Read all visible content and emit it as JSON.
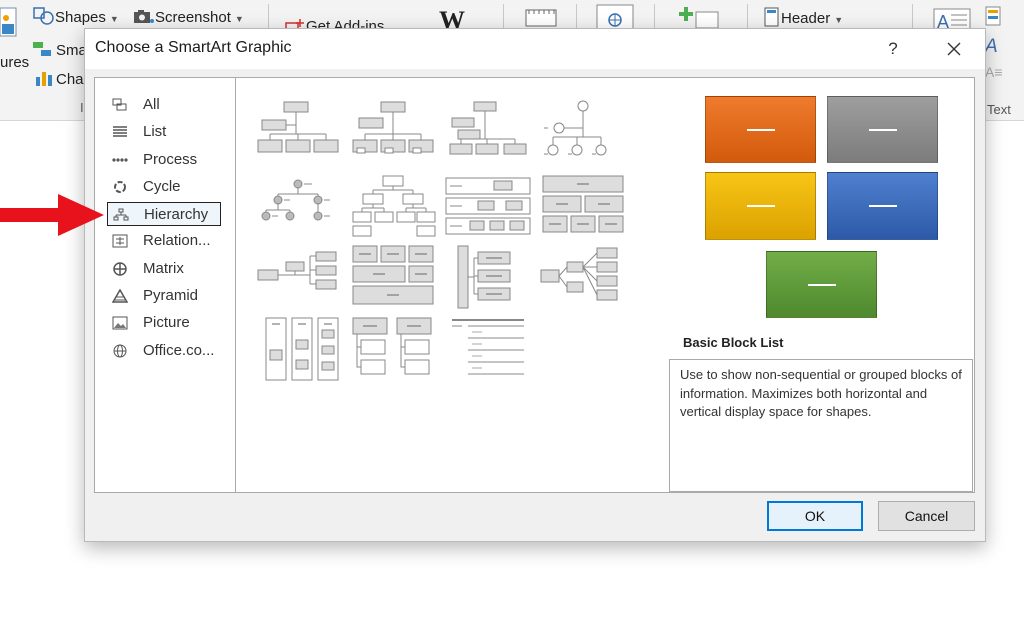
{
  "ribbon": {
    "shapes": "Shapes",
    "screenshot": "Screenshot",
    "smartart_partial": "Sma",
    "chart_partial": "Cha",
    "pictures_partial": "ures",
    "get_addins": "Get Add-ins",
    "wikipedia_glyph": "W",
    "header": "Header",
    "text_group": "Text",
    "illustrations_partial": "Il"
  },
  "dialog": {
    "title": "Choose a SmartArt Graphic",
    "help": "?",
    "categories": [
      {
        "label": "All",
        "icon": "all-icon"
      },
      {
        "label": "List",
        "icon": "list-icon"
      },
      {
        "label": "Process",
        "icon": "process-icon"
      },
      {
        "label": "Cycle",
        "icon": "cycle-icon"
      },
      {
        "label": "Hierarchy",
        "icon": "hierarchy-icon"
      },
      {
        "label": "Relation...",
        "icon": "relationship-icon"
      },
      {
        "label": "Matrix",
        "icon": "matrix-icon"
      },
      {
        "label": "Pyramid",
        "icon": "pyramid-icon"
      },
      {
        "label": "Picture",
        "icon": "picture-icon"
      },
      {
        "label": "Office.co...",
        "icon": "globe-icon"
      }
    ],
    "selected_category": "Hierarchy",
    "preview": {
      "title": "Basic Block List",
      "description": "Use to show non-sequential or grouped blocks of information. Maximizes both horizontal and vertical display space for shapes.",
      "colors": [
        "#e36c1b",
        "#8c8c8c",
        "#f0b400",
        "#3c6fbf",
        "#5f9e3b"
      ]
    },
    "ok": "OK",
    "cancel": "Cancel"
  },
  "colors": {
    "accent": "#0078d7",
    "arrow": "#e8121c"
  }
}
